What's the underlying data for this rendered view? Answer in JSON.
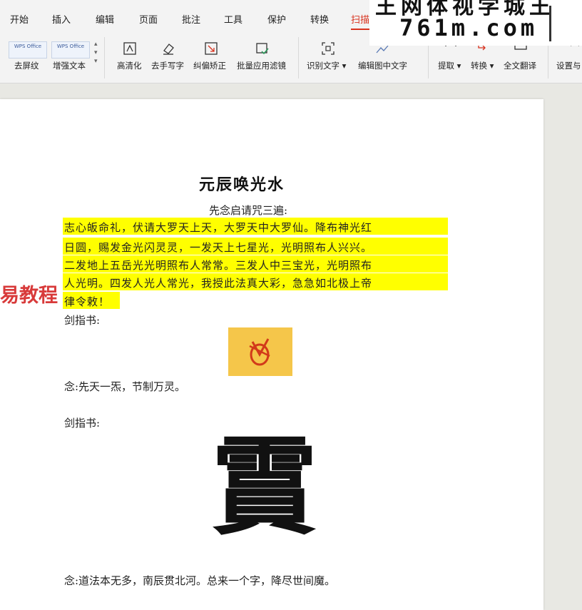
{
  "tabs": [
    {
      "label": "开始",
      "active": false
    },
    {
      "label": "插入",
      "active": false
    },
    {
      "label": "编辑",
      "active": false
    },
    {
      "label": "页面",
      "active": false
    },
    {
      "label": "批注",
      "active": false
    },
    {
      "label": "工具",
      "active": false
    },
    {
      "label": "保护",
      "active": false
    },
    {
      "label": "转换",
      "active": false
    },
    {
      "label": "扫描",
      "active": true
    }
  ],
  "watermark": {
    "site_text": "王网体视学城王",
    "domain": "761m.com"
  },
  "ribbon": {
    "thumb1": "WPS Office",
    "thumb2": "WPS Office",
    "buttons": [
      {
        "label": "去屏纹",
        "icon": "moire-icon"
      },
      {
        "label": "增强文本",
        "icon": "enhance-text-icon"
      },
      {
        "label": "高清化",
        "icon": "hd-icon"
      },
      {
        "label": "去手写字",
        "icon": "eraser-icon"
      },
      {
        "label": "纠偏矫正",
        "icon": "deskew-icon"
      },
      {
        "label": "批量应用滤镜",
        "icon": "batch-filter-icon"
      },
      {
        "label": "识别文字",
        "icon": "ocr-icon"
      },
      {
        "label": "编辑图中文字",
        "icon": "edit-image-text-icon"
      },
      {
        "label": "提取",
        "icon": "extract-icon"
      },
      {
        "label": "转换",
        "icon": "convert-icon"
      },
      {
        "label": "全文翻译",
        "icon": "translate-icon"
      },
      {
        "label": "设置与",
        "icon": "settings-icon"
      }
    ]
  },
  "document": {
    "title": "元辰唤光水",
    "intro": "先念启请咒三遍:",
    "highlight_lines": [
      "志心皈命礼，伏请大罗天上天，大罗天中大罗仙。降布神光红",
      "日圆，赐发金光闪灵灵，一发天上七星光，光明照布人兴兴。",
      "二发地上五岳光光明照布人常常。三发人中三宝光，光明照布",
      "人光明。四发人光人常光，我授此法真大彩，急急如北极上帝",
      "律令敕！"
    ],
    "label1": "剑指书:",
    "chant1": "念:先天一炁，节制万灵。",
    "label2": "剑指书:",
    "big_char": "霣",
    "chant2": "念:道法本无多，南辰贯北河。总来一个字，降尽世间魔。"
  },
  "overlay_text": "易教程",
  "colors": {
    "accent": "#d8321e",
    "highlight": "#ffff00",
    "talisman_bg": "#f5c64a",
    "talisman_ink": "#d23a1a"
  }
}
